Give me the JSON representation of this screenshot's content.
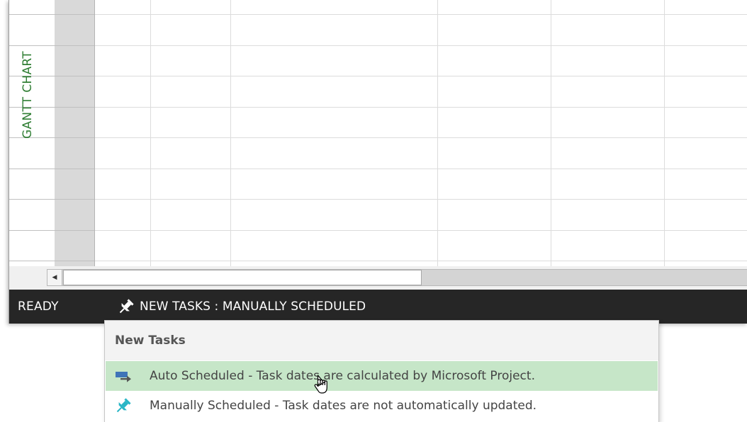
{
  "view": {
    "label": "GANTT CHART"
  },
  "statusbar": {
    "ready": "READY",
    "new_tasks_mode": "NEW TASKS : MANUALLY SCHEDULED",
    "new_tasks_icon": "pushpin-icon"
  },
  "popup": {
    "header": "New Tasks",
    "items": [
      {
        "label": "Auto Scheduled - Task dates are calculated by Microsoft Project.",
        "icon": "auto-scheduled-task-icon",
        "selected": true
      },
      {
        "label": "Manually Scheduled - Task dates are not automatically updated.",
        "icon": "pushpin-icon",
        "selected": false
      }
    ]
  },
  "colors": {
    "view_label": "#2e7d32",
    "statusbar_bg": "#262626",
    "hover_bg": "#c6e6c8",
    "auto_icon": "#3f74b8",
    "manual_pin": "#29b6c6"
  }
}
